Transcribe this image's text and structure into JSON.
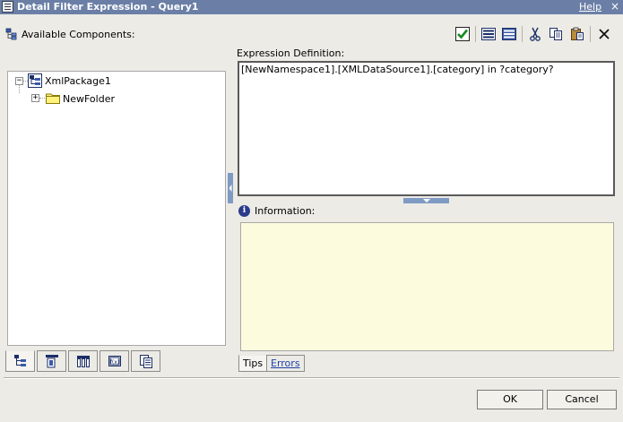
{
  "window": {
    "title": "Detail Filter Expression - Query1",
    "help_label": "Help",
    "close_glyph": "×"
  },
  "left": {
    "heading": "Available Components:",
    "tree": [
      {
        "label": "XmlPackage1",
        "icon": "package-icon",
        "expander": "−"
      },
      {
        "label": "NewFolder",
        "icon": "folder-icon",
        "expander": "+"
      }
    ],
    "tabs": [
      "source-tree-icon",
      "data-items-icon",
      "query-items-icon",
      "functions-icon",
      "parameters-icon"
    ]
  },
  "toolbar": {
    "icons": [
      "validate-check-icon",
      "select-all-icon",
      "clear-icon",
      "cut-icon",
      "copy-icon",
      "paste-icon",
      "delete-icon"
    ]
  },
  "expression": {
    "label": "Expression Definition:",
    "value": "[NewNamespace1].[XMLDataSource1].[category] in ?category?"
  },
  "information": {
    "label": "Information:",
    "icon_glyph": "i",
    "tabs": {
      "tips": "Tips",
      "errors": "Errors"
    }
  },
  "buttons": {
    "ok": "OK",
    "cancel": "Cancel"
  },
  "colors": {
    "titlebar": "#6b7fa6",
    "dialog_bg": "#ecebe6",
    "info_bg": "#fdfbde",
    "accent": "#7f9bc4"
  }
}
